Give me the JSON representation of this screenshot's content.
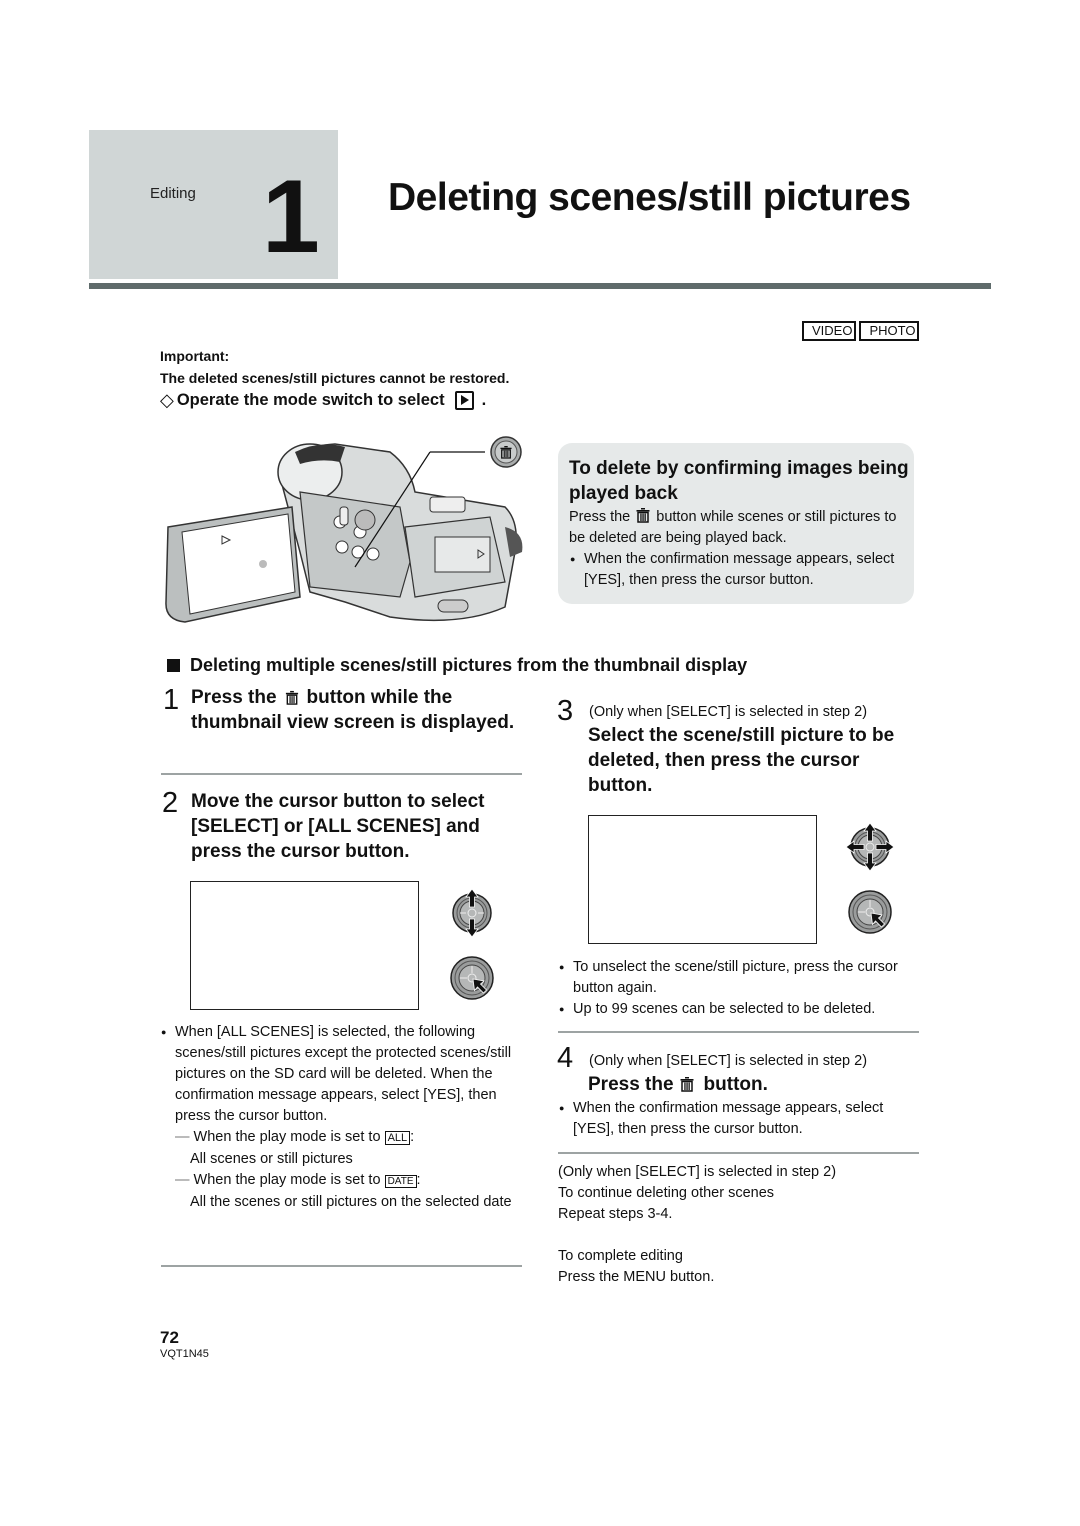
{
  "header": {
    "chapter_label": "Editing",
    "chapter_number": "1",
    "title": "Deleting scenes/still pictures"
  },
  "mode_tags": [
    "VIDEO",
    "PHOTO"
  ],
  "important": {
    "label": "Important:",
    "text": "The deleted scenes/still pictures cannot be restored."
  },
  "operate": {
    "prefix": "Operate the mode switch to select",
    "suffix": ".",
    "icon": "play-mode-icon"
  },
  "camera_illustration": {
    "icon": "delete-button-callout-icon"
  },
  "info_box": {
    "title": "To delete by confirming images being played back",
    "body_pre": "Press the",
    "body_post": "button while scenes or still pictures to be deleted are being played back.",
    "bullet": "When the confirmation message appears, select [YES], then press the cursor button."
  },
  "section": {
    "title": "Deleting multiple scenes/still pictures from the thumbnail display"
  },
  "steps": [
    {
      "number": "1",
      "title_pre": "Press the",
      "title_post": "button while the thumbnail view screen is displayed."
    },
    {
      "number": "2",
      "title": "Move the cursor button to select [SELECT] or [ALL SCENES] and press the cursor button.",
      "bullet": "When [ALL SCENES] is selected, the following scenes/still pictures except the protected scenes/still pictures on the SD card will be deleted. When the confirmation message appears, select [YES], then press the cursor button.",
      "sub_items": [
        {
          "pre": "When the play mode is set to",
          "badge": "ALL",
          "post": ":",
          "detail": "All scenes or still pictures"
        },
        {
          "pre": "When the play mode is set to",
          "badge": "DATE",
          "post": ":",
          "detail": "All the scenes or still pictures on the selected date"
        }
      ]
    },
    {
      "number": "3",
      "note": "(Only when [SELECT] is selected in step 2)",
      "title": "Select the scene/still picture to be deleted, then press the cursor button.",
      "bullets": [
        "To unselect the scene/still picture, press the cursor button again.",
        "Up to 99 scenes can be selected to be deleted."
      ]
    },
    {
      "number": "4",
      "note": "(Only when [SELECT] is selected in step 2)",
      "title_pre": "Press the",
      "title_post": "button.",
      "bullet": "When the confirmation message appears, select [YES], then press the cursor button."
    }
  ],
  "footer_notes": {
    "continue": [
      "(Only when [SELECT] is selected in step 2)",
      "To continue deleting other scenes",
      "Repeat steps 3-4."
    ],
    "complete": [
      "To complete editing",
      "Press the MENU button."
    ]
  },
  "page": {
    "number": "72",
    "code": "VQT1N45"
  }
}
